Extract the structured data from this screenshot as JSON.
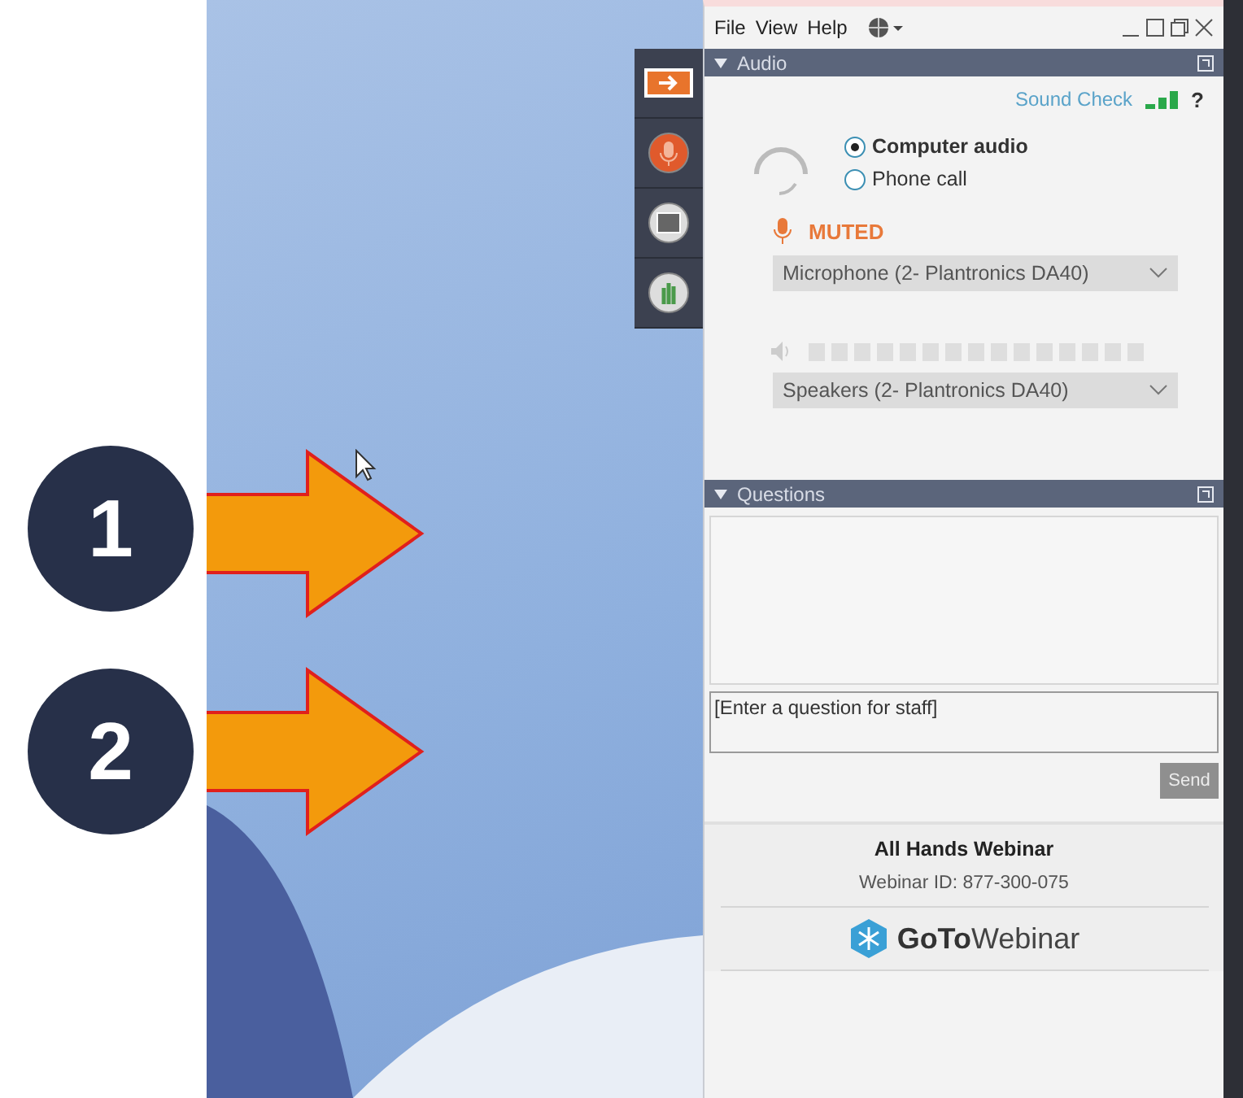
{
  "callouts": [
    {
      "number": "1"
    },
    {
      "number": "2"
    }
  ],
  "toolbar": [
    {
      "selected": true
    },
    {
      "selected": false
    },
    {
      "selected": false
    },
    {
      "selected": false
    }
  ],
  "menu": [
    "File",
    "View",
    "Help"
  ],
  "audio": {
    "title": "Audio",
    "expanded": true,
    "sound_check": "Sound Check",
    "help": "?",
    "options": [
      {
        "label": "Computer audio",
        "selected": true
      },
      {
        "label": "Phone call",
        "selected": false
      }
    ],
    "mute_status": "MUTED",
    "muted": true,
    "microphone": "Microphone (2- Plantronics DA40)",
    "speakers": "Speakers (2- Plantronics DA40)"
  },
  "questions": {
    "title": "Questions",
    "expanded": true,
    "placeholder": "[Enter a question for staff]",
    "send": {
      "label": "Send",
      "disabled": true
    }
  },
  "footer": {
    "title": "All Hands Webinar",
    "webinar_id": "Webinar ID: 877-300-075",
    "logo": "**GoTo**Webinar"
  }
}
